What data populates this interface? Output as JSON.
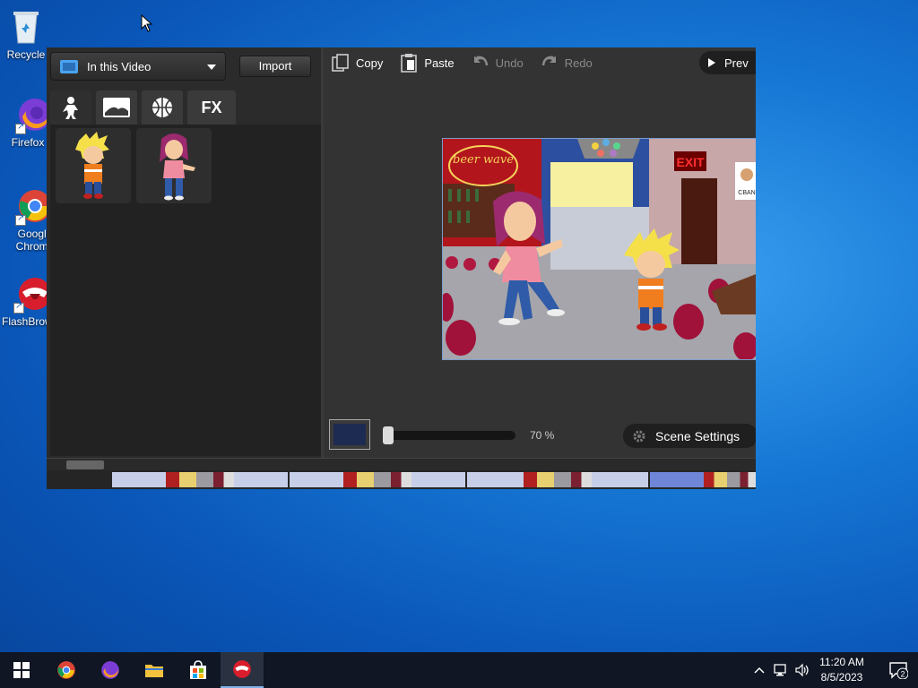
{
  "desktop": {
    "icons": [
      {
        "label": "Recycle",
        "icon": "recycle-bin-icon"
      },
      {
        "label": "Firefox",
        "icon": "firefox-icon"
      },
      {
        "label": "Google Chrome",
        "icon": "chrome-icon"
      },
      {
        "label": "FlashBrowser",
        "icon": "flashbrowser-icon"
      }
    ]
  },
  "app": {
    "left_panel": {
      "dropdown_label": "In this Video",
      "import_label": "Import",
      "tabs": [
        {
          "name": "characters",
          "icon": "character-icon"
        },
        {
          "name": "backgrounds",
          "icon": "background-icon"
        },
        {
          "name": "props",
          "icon": "ball-icon"
        },
        {
          "name": "effects",
          "label": "FX"
        }
      ],
      "thumbnails": [
        {
          "name": "blonde-boy-character"
        },
        {
          "name": "pink-hair-girl-character"
        }
      ]
    },
    "toolbar": {
      "copy": "Copy",
      "paste": "Paste",
      "undo": "Undo",
      "redo": "Redo",
      "preview": "Prev"
    },
    "stage": {
      "sign_text": "beer wave",
      "exit_text": "EXIT",
      "poster_text": "CBAN"
    },
    "bottom": {
      "zoom_label": "70 %",
      "scene_settings": "Scene Settings"
    }
  },
  "taskbar": {
    "time": "11:20 AM",
    "date": "8/5/2023",
    "notifications": "2"
  },
  "colors": {
    "desktop_bg": "#1677d4",
    "panel_bg": "#2b2b2b",
    "accent": "#6f86d8"
  }
}
